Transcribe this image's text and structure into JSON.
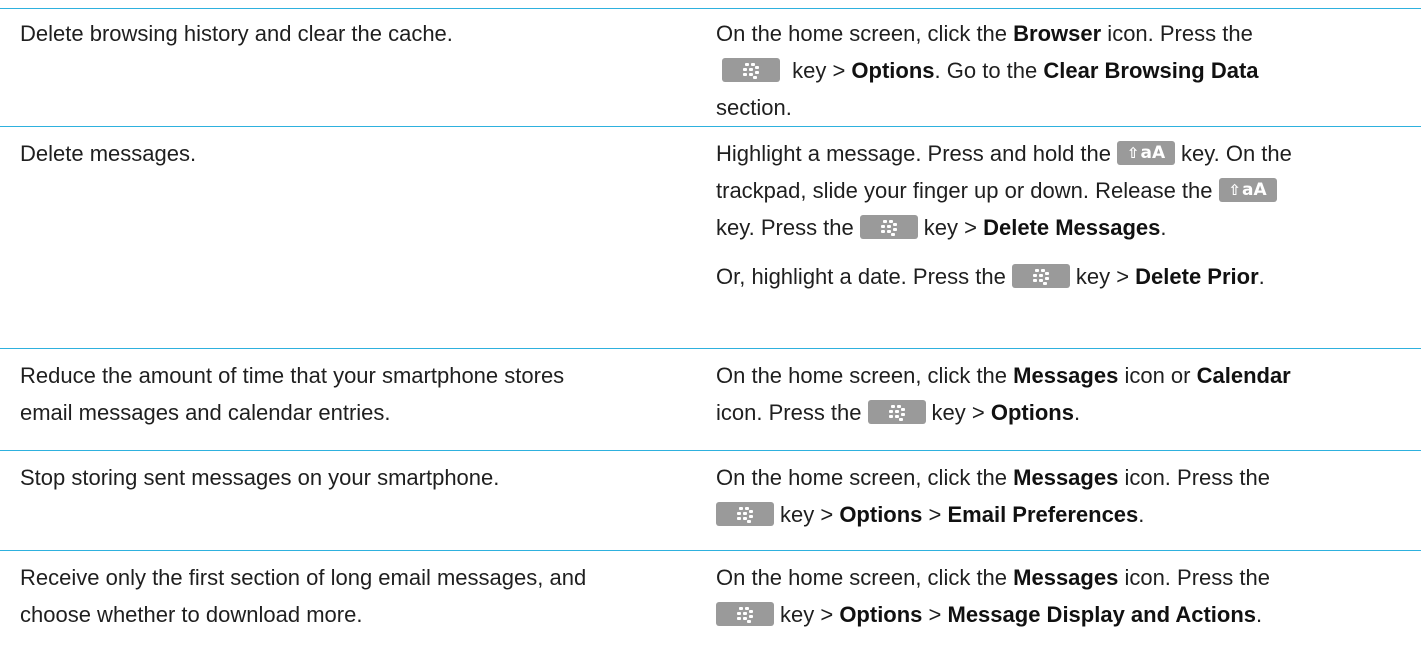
{
  "key_icons": {
    "menu": "blackberry-menu-key-icon",
    "shift": "shift-aA-key-icon"
  },
  "colors": {
    "rule": "#2eb1de",
    "key": "#9a9a9a",
    "text": "#1f1f1f"
  },
  "shift_key": {
    "glyph": "⇧",
    "label": "aA"
  },
  "rows": [
    {
      "task": "Delete browsing history and clear the cache.",
      "t1": "On the home screen, click the ",
      "b1": "Browser",
      "t2": " icon. Press the",
      "t3": " key > ",
      "b2": "Options",
      "t4": ". Go to the ",
      "b3": "Clear Browsing Data",
      "t5": "section."
    },
    {
      "task": "Delete messages.",
      "t1": "Highlight a message. Press and hold the",
      "t2": "key. On the",
      "t3": "trackpad, slide your finger up or down. Release the",
      "t4": "key. Press the",
      "t5": "key > ",
      "b1": "Delete Messages",
      "t6": ".",
      "alt_t1": "Or, highlight a date. Press the",
      "alt_t2": "key > ",
      "alt_b1": "Delete Prior",
      "alt_t3": "."
    },
    {
      "task_line1": "Reduce the amount of time that your smartphone stores",
      "task_line2": "email messages and calendar entries.",
      "t1": "On the home screen, click the ",
      "b1": "Messages",
      "t2": " icon or ",
      "b2": "Calendar",
      "t3": "icon. Press the",
      "t4": "key > ",
      "b3": "Options",
      "t5": "."
    },
    {
      "task": "Stop storing sent messages on your smartphone.",
      "t1": "On the home screen, click the ",
      "b1": "Messages",
      "t2": " icon. Press the",
      "t3": "key > ",
      "b2": "Options",
      "t4": " > ",
      "b3": "Email Preferences",
      "t5": "."
    },
    {
      "task_line1": "Receive only the first section of long email messages, and",
      "task_line2": "choose whether to download more.",
      "t1": "On the home screen, click the ",
      "b1": "Messages",
      "t2": " icon. Press the",
      "t3": "key > ",
      "b2": "Options",
      "t4": " > ",
      "b3": "Message Display and Actions",
      "t5": "."
    }
  ]
}
